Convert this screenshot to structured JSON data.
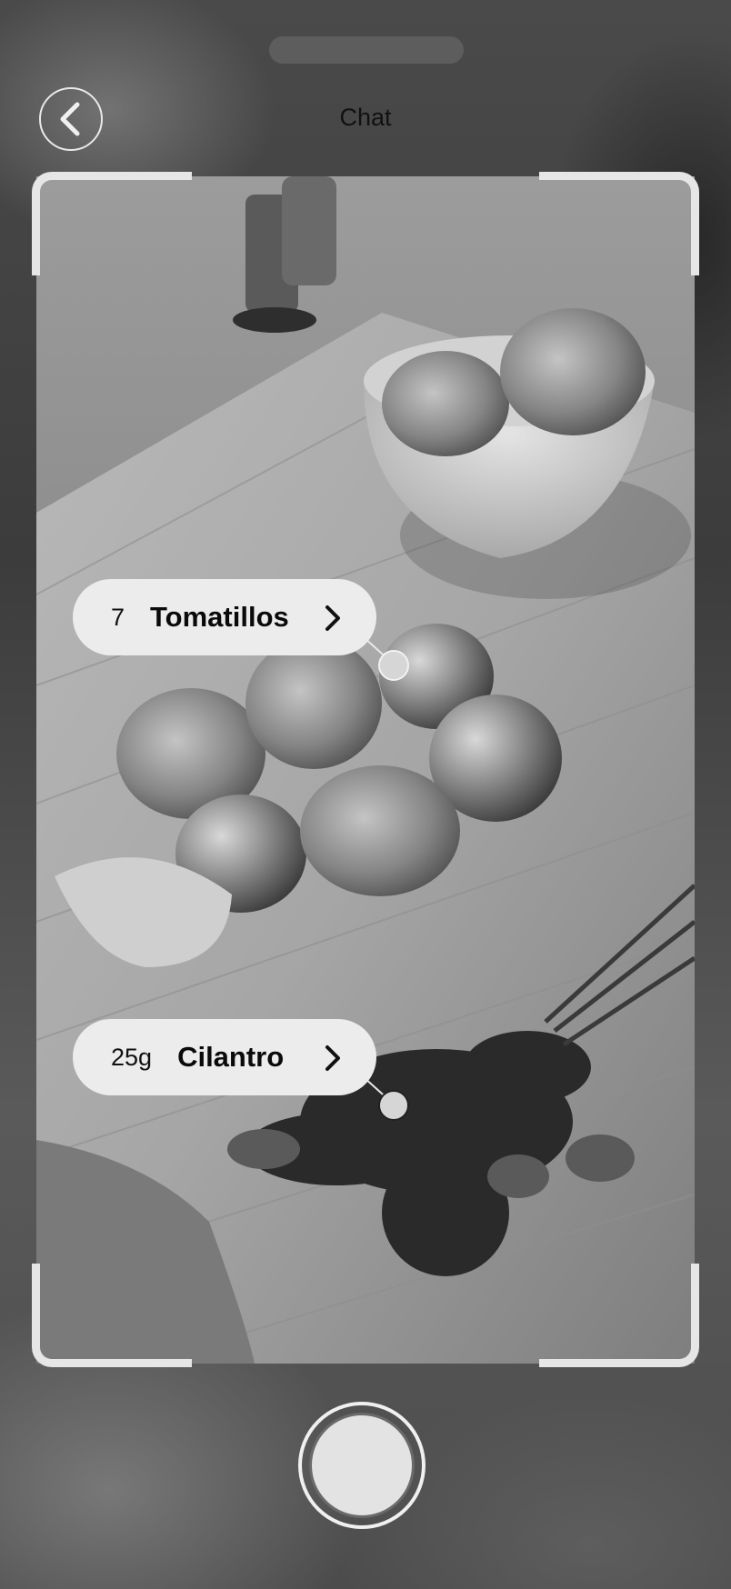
{
  "header": {
    "title": "Chat",
    "back_icon": "chevron-left-icon"
  },
  "scan": {
    "image_subject": "tomatillos and cilantro on a wooden cutting board",
    "items": [
      {
        "quantity": "7",
        "name": "Tomatillos",
        "icon": "chevron-right-icon"
      },
      {
        "quantity": "25g",
        "name": "Cilantro",
        "icon": "chevron-right-icon"
      }
    ]
  },
  "capture": {
    "icon": "shutter-button"
  },
  "colors": {
    "chip_background": "#ececec",
    "frame_corners": "#e6e6e6",
    "text": "#111111"
  }
}
